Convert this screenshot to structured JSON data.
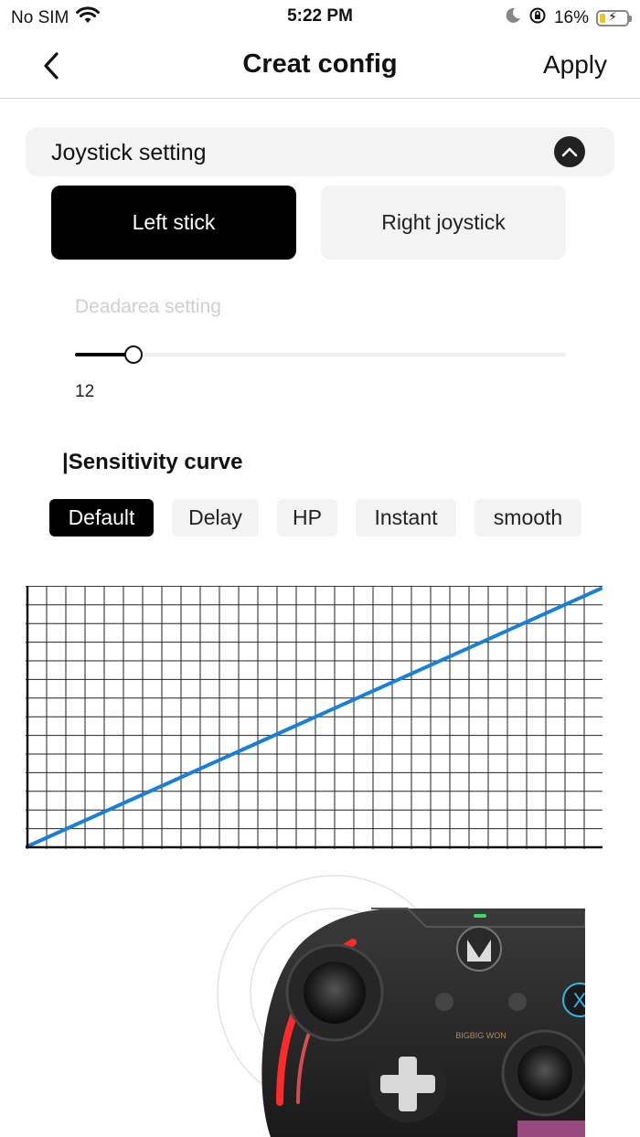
{
  "status": {
    "carrier": "No SIM",
    "time": "5:22 PM",
    "battery": "16%"
  },
  "nav": {
    "title": "Creat config",
    "apply": "Apply"
  },
  "joystick": {
    "section_title": "Joystick setting",
    "left_label": "Left stick",
    "right_label": "Right joystick",
    "selected": "Left stick"
  },
  "deadarea": {
    "label": "Deadarea setting",
    "value": "12",
    "fraction": 0.12
  },
  "sensitivity": {
    "title": "|Sensitivity curve",
    "tabs": [
      "Default",
      "Delay",
      "HP",
      "Instant",
      "smooth"
    ],
    "selected": "Default"
  },
  "colors": {
    "accent": "#000000",
    "curve": "#1a7fd6",
    "tab_bg": "#f3f3f3"
  },
  "controller": {
    "brand": "BIGBIG WON"
  }
}
